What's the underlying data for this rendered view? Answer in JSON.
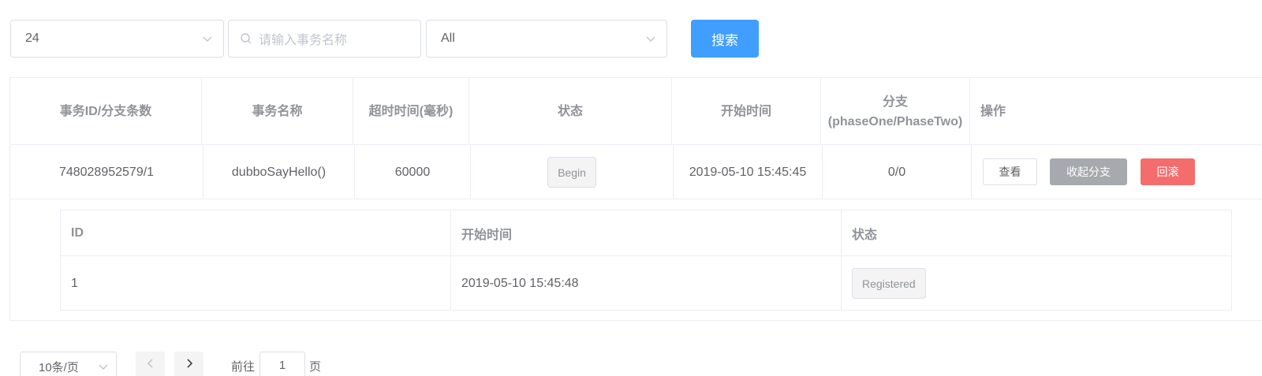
{
  "filters": {
    "page_size_value": "24",
    "search_placeholder": "请输入事务名称",
    "status_value": "All",
    "search_button": "搜索"
  },
  "table": {
    "headers": [
      "事务ID/分支条数",
      "事务名称",
      "超时时间(毫秒)",
      "状态",
      "开始时间",
      "分支(phaseOne/PhaseTwo)",
      "操作"
    ],
    "rows": [
      {
        "id_branches": "748028952579/1",
        "name": "dubboSayHello()",
        "timeout": "60000",
        "status": "Begin",
        "start_time": "2019-05-10 15:45:45",
        "branches": "0/0",
        "actions": {
          "view": "查看",
          "collapse": "收起分支",
          "rollback": "回滚"
        }
      }
    ],
    "branch_table": {
      "headers": [
        "ID",
        "开始时间",
        "状态"
      ],
      "rows": [
        {
          "id": "1",
          "start_time": "2019-05-10 15:45:48",
          "status": "Registered"
        }
      ]
    }
  },
  "pagination": {
    "page_size": "10条/页",
    "goto_label": "前往",
    "goto_value": "1",
    "goto_unit": "页"
  },
  "colors": {
    "primary": "#409eff",
    "danger": "#f56c6c",
    "info": "#a6a9ad",
    "border": "#ebeef5"
  }
}
